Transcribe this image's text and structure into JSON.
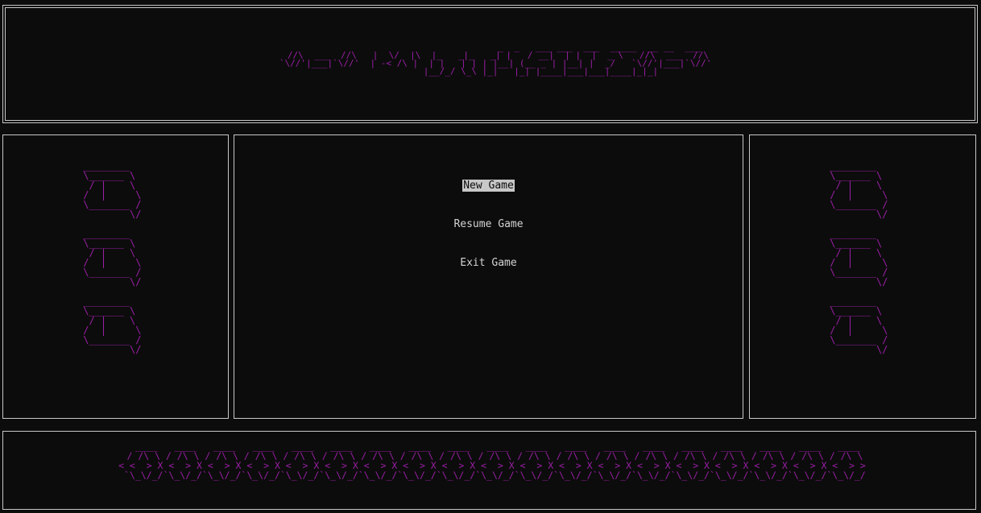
{
  "title_art": [
    "                                           _  _   ___ ___  ___  _____  __ __  ___  ",
    "   //\\  ___  //\\   |  \\/  |\\  |_   _|_   _| |   / __|  | |  |  _ \\   //\\  ___  //\\",
    "  `\\//'|___|`\\//'  | -< /\\ |  | |   | | | |__| (__ _ | |__| |  _/   `\\//'|___|`\\//'",
    "                   |__/_/ \\_\\ |_|   |_| |____|___|___|____|_|_|",
    ""
  ],
  "ship_art": [
    " ________",
    " \\______ \\",
    "  / |    \\",
    " /  |     \\",
    " \\_______ /",
    "         \\/"
  ],
  "footer_art": [
    "   ____   ____   ____   ____   ____   ____   ____   ____   ____   ____   ____   ____   ____   ____   ____   ____   ____   ____   ____",
    "  / /\\ \\ / /\\ \\ / /\\ \\ / /\\ \\ / /\\ \\ / /\\ \\ / /\\ \\ / /\\ \\ / /\\ \\ / /\\ \\ / /\\ \\ / /\\ \\ / /\\ \\ / /\\ \\ / /\\ \\ / /\\ \\ / /\\ \\ / /\\ \\ / /\\ \\",
    " < <  > X <  > X <  > X <  > X <  > X <  > X <  > X <  > X <  > X <  > X <  > X <  > X <  > X <  > X <  > X <  > X <  > X <  > X <  > >",
    "  `\\_\\/_/`\\_\\/_/`\\_\\/_/`\\_\\/_/`\\_\\/_/`\\_\\/_/`\\_\\/_/`\\_\\/_/`\\_\\/_/`\\_\\/_/`\\_\\/_/`\\_\\/_/`\\_\\/_/`\\_\\/_/`\\_\\/_/`\\_\\/_/`\\_\\/_/`\\_\\/_/`\\_\\/_/"
  ],
  "menu": {
    "items": [
      {
        "label": "New Game",
        "selected": true
      },
      {
        "label": "Resume Game",
        "selected": false
      },
      {
        "label": "Exit Game",
        "selected": false
      }
    ]
  },
  "colors": {
    "art": "#9b1fa6",
    "text": "#d4d4d4",
    "background": "#0c0c0c",
    "selection_bg": "#c8c8c8"
  }
}
